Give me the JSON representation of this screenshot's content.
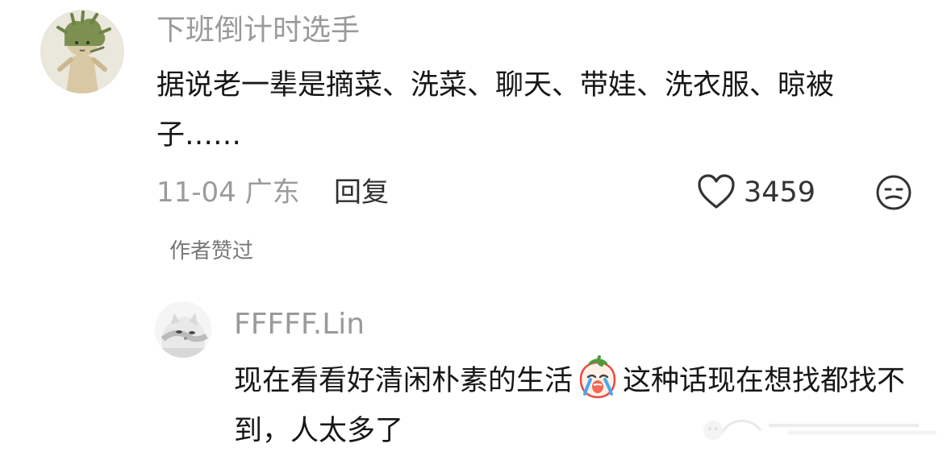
{
  "comment": {
    "username": "下班倒计时选手",
    "text": "据说老一辈是摘菜、洗菜、聊天、带娃、洗衣服、晾被子……",
    "date_location": "11-04 广东",
    "reply_label": "回复",
    "like_count": "3459",
    "icons": {
      "like": "heart-icon",
      "emoji": "emoji-icon"
    },
    "author_liked_label": "作者赞过"
  },
  "reply": {
    "username": "FFFFF.Lin",
    "text_part1": "现在看看好清闲朴素的生活",
    "text_part2": "这种话现在想找都找不到，人太多了",
    "inline_emoji": "crying-tomato-emoji-icon"
  },
  "colors": {
    "secondary_text": "#9b9b9b",
    "primary_text": "#171717"
  }
}
